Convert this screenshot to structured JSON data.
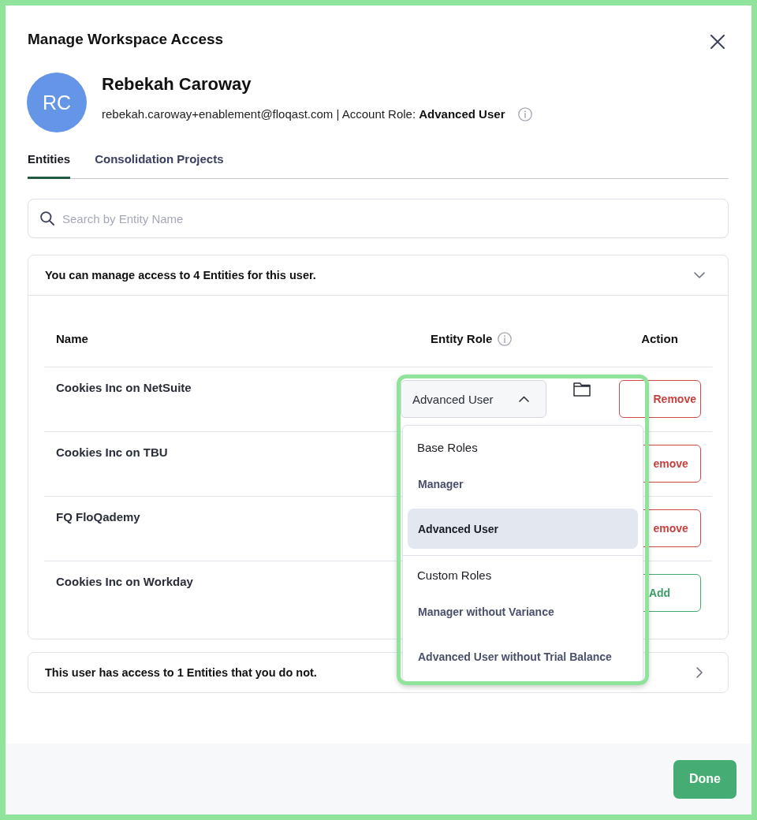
{
  "dialog": {
    "title": "Manage Workspace Access",
    "highlighted": true
  },
  "user": {
    "initials": "RC",
    "name": "Rebekah Caroway",
    "details": "rebekah.caroway+enablement@floqast.com | Account Role: **Advanced User**"
  },
  "tabs": [
    {
      "label": "Entities",
      "selected": true
    },
    {
      "label": "Consolidation Projects",
      "selected": false
    }
  ],
  "search": {
    "placeholder": "Search by Entity Name"
  },
  "managed_panel": {
    "summary": "You can manage access to 4 Entities for this user.",
    "expanded": true,
    "columns": [
      {
        "label": "Name"
      },
      {
        "label": "Entity Role",
        "info": true
      },
      {
        "label": "Action"
      }
    ],
    "rows": [
      {
        "name": "Cookies Inc on NetSuite",
        "role": {
          "value": "Advanced User",
          "expanded": true,
          "highlighted": true,
          "menu": [
            {
              "heading": "Base Roles",
              "options": [
                {
                  "label": "Manager",
                  "selected": false
                },
                {
                  "label": "Advanced User",
                  "selected": true
                }
              ]
            },
            {
              "heading": "Custom Roles",
              "options": [
                {
                  "label": "Manager without Variance",
                  "selected": false
                },
                {
                  "label": "Advanced User without Trial Balance",
                  "selected": false
                }
              ]
            }
          ]
        },
        "action": {
          "kind": "remove",
          "label": "Remove"
        }
      },
      {
        "name": "Cookies Inc on TBU",
        "action": {
          "kind": "remove",
          "label": "emove"
        }
      },
      {
        "name": "FQ FloQademy",
        "action": {
          "kind": "remove",
          "label": "emove"
        }
      },
      {
        "name": "Cookies Inc on Workday",
        "action": {
          "kind": "add",
          "label": "Add"
        }
      }
    ]
  },
  "other_panel": {
    "summary": "This user has access to 1 Entities that you do not.",
    "expanded": false
  },
  "footer": {
    "done": "Done"
  }
}
